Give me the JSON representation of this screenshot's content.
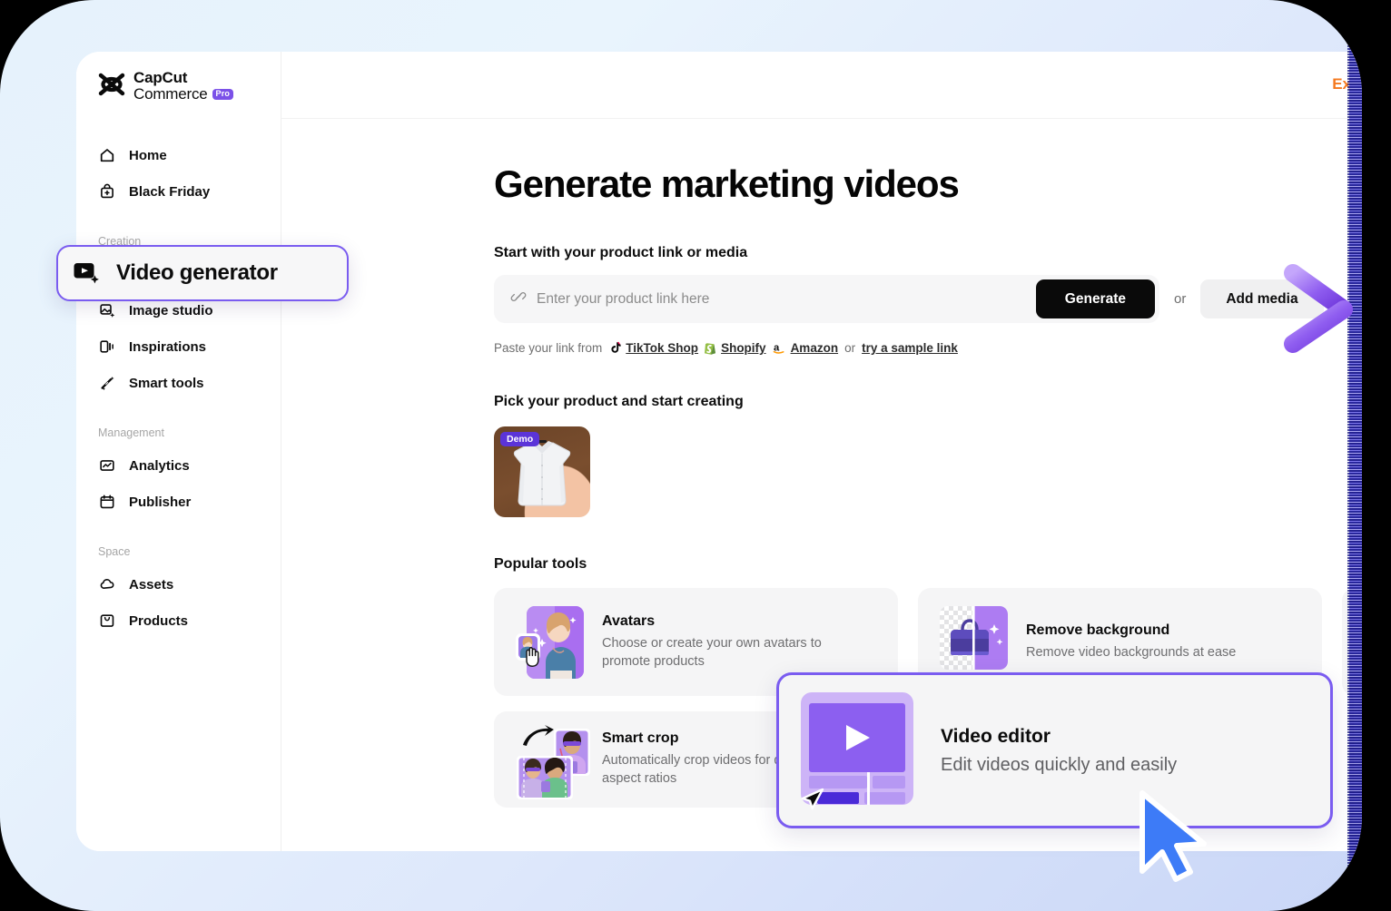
{
  "brand": {
    "name_line1": "CapCut",
    "name_line2": "Commerce",
    "badge": "Pro"
  },
  "sidebar": {
    "items": [
      {
        "label": "Home",
        "icon": "home-icon",
        "group": null
      },
      {
        "label": "Black Friday",
        "icon": "bag-icon",
        "group": null
      }
    ],
    "groups": [
      {
        "title": "Creation",
        "items": [
          {
            "label": "Video generator",
            "icon": "video-generator-icon",
            "active": true
          },
          {
            "label": "Image studio",
            "icon": "image-studio-icon",
            "active": false
          },
          {
            "label": "Inspirations",
            "icon": "inspirations-icon",
            "active": false
          },
          {
            "label": "Smart tools",
            "icon": "magic-wand-icon",
            "active": false
          }
        ]
      },
      {
        "title": "Management",
        "items": [
          {
            "label": "Analytics",
            "icon": "analytics-icon",
            "active": false
          },
          {
            "label": "Publisher",
            "icon": "calendar-icon",
            "active": false
          }
        ]
      },
      {
        "title": "Space",
        "items": [
          {
            "label": "Assets",
            "icon": "cloud-icon",
            "active": false
          },
          {
            "label": "Products",
            "icon": "products-icon",
            "active": false
          }
        ]
      }
    ]
  },
  "topbar": {
    "cta": "Ex"
  },
  "main": {
    "title": "Generate marketing videos",
    "start_section_label": "Start with your product link or media",
    "link_input": {
      "placeholder": "Enter your product link here",
      "value": ""
    },
    "generate_button": "Generate",
    "or_text": "or",
    "add_media_button": "Add media",
    "paste_prefix": "Paste your link from",
    "paste_sources": [
      {
        "label": "TikTok Shop",
        "icon": "tiktok-icon"
      },
      {
        "label": "Shopify",
        "icon": "shopify-icon"
      },
      {
        "label": "Amazon",
        "icon": "amazon-icon"
      }
    ],
    "paste_or": "or",
    "sample_link": "try a sample link",
    "pick_product_label": "Pick your product and start creating",
    "product": {
      "badge": "Demo",
      "alt": "white dress shirt"
    },
    "popular_tools_label": "Popular tools",
    "tools": [
      {
        "title": "Avatars",
        "desc": "Choose or create your own avatars to promote products",
        "icon": "avatars-thumbnail"
      },
      {
        "title": "Remove background",
        "desc": "Remove video backgrounds at ease",
        "icon": "remove-background-thumbnail"
      },
      {
        "title": "Smart crop",
        "desc": "Automatically crop videos for different aspect ratios",
        "icon": "smart-crop-thumbnail"
      }
    ]
  },
  "zoom_highlight": {
    "sidebar_item_label": "Video generator"
  },
  "zoom_card": {
    "title": "Video editor",
    "subtitle": "Edit videos quickly and easily",
    "icon": "video-editor-thumbnail"
  },
  "colors": {
    "accent_purple": "#7a5cf0",
    "badge_purple": "#5b34d8",
    "cta_orange": "#f4791f",
    "cursor_blue": "#3d7bf7",
    "page_bg": "#e6f2fc",
    "edge_blue": "#4f46e5"
  }
}
